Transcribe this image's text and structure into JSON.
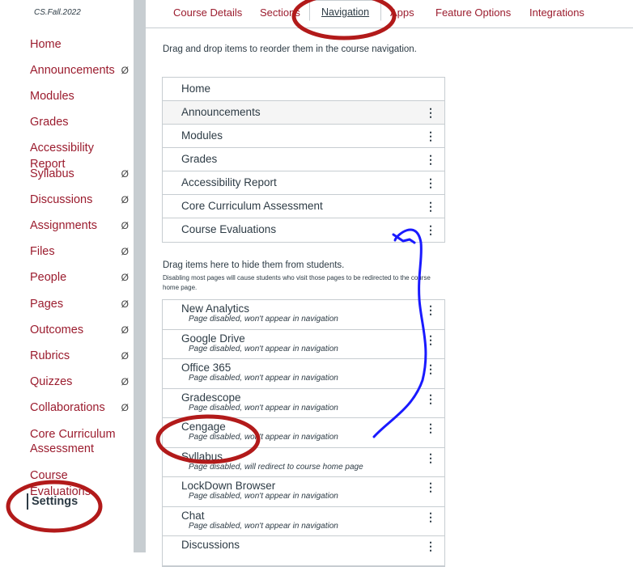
{
  "sidebar": {
    "course_code": "CS.Fall.2022",
    "items": [
      {
        "label": "Home",
        "hidden": false
      },
      {
        "label": "Announcements",
        "hidden": true
      },
      {
        "label": "Modules",
        "hidden": false
      },
      {
        "label": "Grades",
        "hidden": false
      },
      {
        "label": "Accessibility Report",
        "hidden": false
      },
      {
        "label": "Syllabus",
        "hidden": true
      },
      {
        "label": "Discussions",
        "hidden": true
      },
      {
        "label": "Assignments",
        "hidden": true
      },
      {
        "label": "Files",
        "hidden": true
      },
      {
        "label": "People",
        "hidden": true
      },
      {
        "label": "Pages",
        "hidden": true
      },
      {
        "label": "Outcomes",
        "hidden": true
      },
      {
        "label": "Rubrics",
        "hidden": true
      },
      {
        "label": "Quizzes",
        "hidden": true
      },
      {
        "label": "Collaborations",
        "hidden": true
      },
      {
        "label": "Core Curriculum Assessment",
        "hidden": false
      },
      {
        "label": "Course Evaluations",
        "hidden": false
      },
      {
        "label": "Settings",
        "hidden": false,
        "active": true
      }
    ],
    "hidden_icon": "eye-slash-icon"
  },
  "tabs": [
    {
      "label": "Course Details"
    },
    {
      "label": "Sections"
    },
    {
      "label": "Navigation",
      "active": true
    },
    {
      "label": "Apps"
    },
    {
      "label": "Feature Options"
    },
    {
      "label": "Integrations"
    }
  ],
  "instructions": "Drag and drop items to reorder them in the course navigation.",
  "enabled_items": [
    "Home",
    "Announcements",
    "Modules",
    "Grades",
    "Accessibility Report",
    "Core Curriculum Assessment",
    "Course Evaluations"
  ],
  "hidden_header": "Drag items here to hide them from students.",
  "hidden_note": "Disabling most pages will cause students who visit those pages to be redirected to the course home page.",
  "disabled_items": [
    {
      "title": "New Analytics",
      "status": "Page disabled, won't appear in navigation"
    },
    {
      "title": "Google Drive",
      "status": "Page disabled, won't appear in navigation"
    },
    {
      "title": "Office 365",
      "status": "Page disabled, won't appear in navigation"
    },
    {
      "title": "Gradescope",
      "status": "Page disabled, won't appear in navigation"
    },
    {
      "title": "Cengage",
      "status": "Page disabled, won't appear in navigation"
    },
    {
      "title": "Syllabus",
      "status": "Page disabled, will redirect to course home page"
    },
    {
      "title": "LockDown Browser",
      "status": "Page disabled, won't appear in navigation"
    },
    {
      "title": "Chat",
      "status": "Page disabled, won't appear in navigation"
    },
    {
      "title": "Discussions",
      "status": ""
    }
  ],
  "kebab_glyph": "⋮",
  "colors": {
    "link": "#9b1c2e",
    "text": "#2d3b45",
    "annotation_red": "#b21a1a",
    "annotation_blue": "#1a1aff"
  }
}
